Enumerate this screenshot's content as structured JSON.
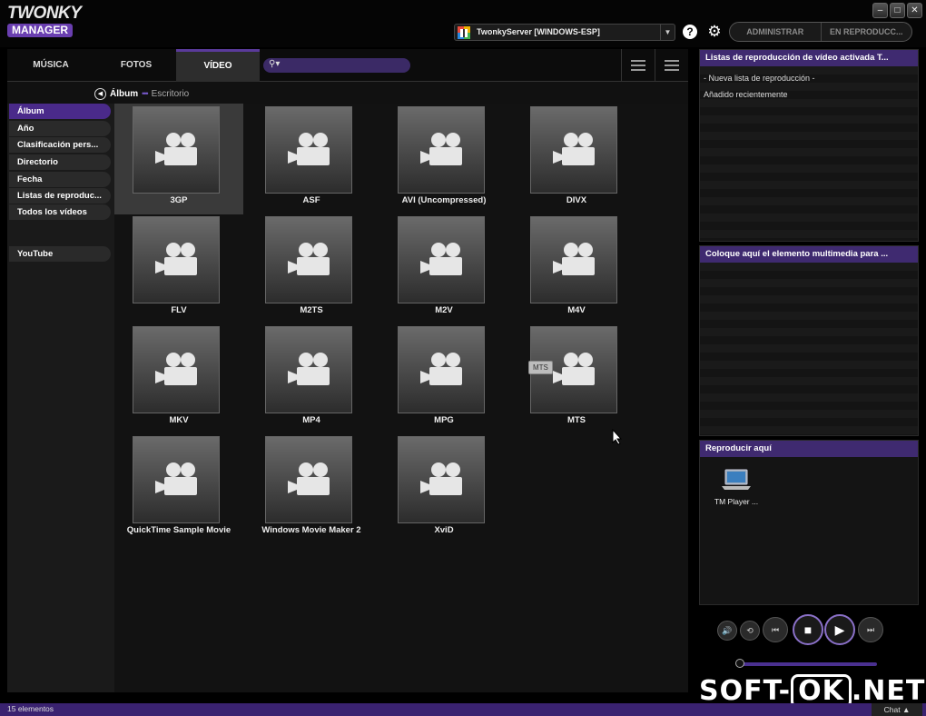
{
  "app": {
    "logo_line1": "TWONKY",
    "logo_line2": "MANAGER",
    "server_name": "TwonkyServer [WINDOWS-ESP]",
    "help_icon": "help-icon",
    "settings_icon": "gear-icon",
    "top_buttons": [
      "ADMINISTRAR",
      "EN REPRODUCC..."
    ],
    "window_buttons": [
      "minimize-icon",
      "restore-icon",
      "close-icon"
    ]
  },
  "tabs": [
    "MÚSICA",
    "FOTOS",
    "VÍDEO"
  ],
  "active_tab": "VÍDEO",
  "breadcrumb": {
    "current": "Álbum",
    "separator": "•••",
    "location": "Escritorio"
  },
  "sidebar": {
    "items": [
      "Álbum",
      "Año",
      "Clasificación pers...",
      "Directorio",
      "Fecha",
      "Listas de reproduc...",
      "Todos los vídeos"
    ],
    "selected": "Álbum",
    "extra": "YouTube"
  },
  "grid": {
    "items": [
      "3GP",
      "ASF",
      "AVI (Uncompressed)",
      "DIVX",
      "FLV",
      "M2TS",
      "M2V",
      "M4V",
      "MKV",
      "MP4",
      "MPG",
      "MTS",
      "QuickTime Sample Movie",
      "Windows Movie Maker 2",
      "XviD"
    ],
    "selected": "3GP",
    "tooltip": "MTS"
  },
  "right": {
    "playlists_title": "Listas de reproducción de vídeo activada T...",
    "playlists": [
      "- Nueva lista de reproducción -",
      "Añadido recientemente"
    ],
    "drop_title": "Coloque aquí el elemento multimedia para ...",
    "play_here_title": "Reproducir aquí",
    "device_name": "TM Player ..."
  },
  "player": {
    "icons": [
      "volume-icon",
      "repeat-icon",
      "previous-icon",
      "stop-icon",
      "play-icon",
      "next-icon"
    ],
    "seek_position": 0
  },
  "status": {
    "count_text": "15 elementos",
    "chat_label": "Chat"
  },
  "watermark": {
    "left": "SOFT-",
    "box": "OK",
    "right": ".NET"
  },
  "colors": {
    "accent": "#4a2a8a",
    "header": "#3f2a70",
    "status": "#3a2270"
  }
}
